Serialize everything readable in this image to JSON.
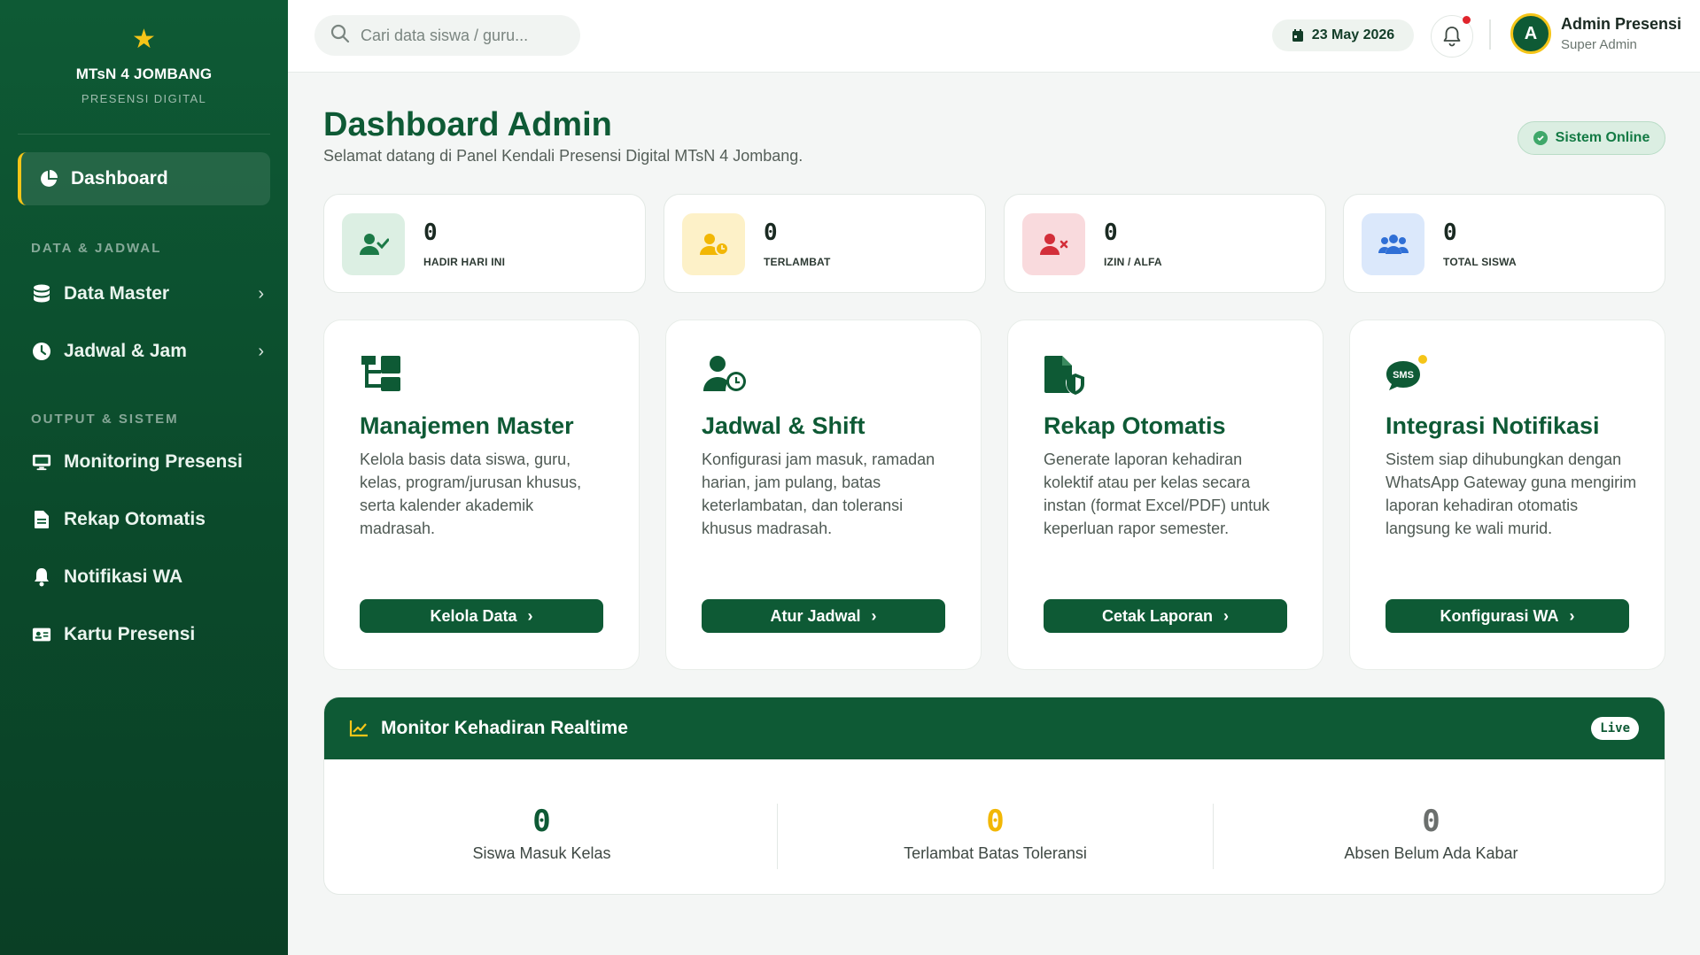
{
  "brand": {
    "name": "MTsN 4 JOMBANG",
    "subtitle": "PRESENSI DIGITAL"
  },
  "sidebar": {
    "active": {
      "label": "Dashboard",
      "icon": "pie-chart-icon"
    },
    "sections": [
      {
        "title": "DATA & JADWAL",
        "items": [
          {
            "label": "Data Master",
            "icon": "database-icon",
            "has_submenu": true
          },
          {
            "label": "Jadwal & Jam",
            "icon": "clock-icon",
            "has_submenu": true
          }
        ]
      },
      {
        "title": "OUTPUT & SISTEM",
        "items": [
          {
            "label": "Monitoring Presensi",
            "icon": "monitor-icon"
          },
          {
            "label": "Rekap Otomatis",
            "icon": "file-icon"
          },
          {
            "label": "Notifikasi WA",
            "icon": "bell-icon"
          },
          {
            "label": "Kartu Presensi",
            "icon": "id-card-icon"
          }
        ]
      }
    ]
  },
  "topbar": {
    "search_placeholder": "Cari data siswa / guru...",
    "date": "23 May 2026",
    "user": {
      "initial": "A",
      "name": "Admin Presensi",
      "role": "Super Admin"
    }
  },
  "header": {
    "title": "Dashboard Admin",
    "subtitle": "Selamat datang di Panel Kendali Presensi Digital MTsN 4 Jombang.",
    "status": "Sistem Online"
  },
  "stats": [
    {
      "value": "0",
      "label": "HADIR HARI INI",
      "icon": "user-check-icon",
      "bg": "#dcefe3",
      "fg": "#1c7a47"
    },
    {
      "value": "0",
      "label": "TERLAMBAT",
      "icon": "user-clock-icon",
      "bg": "#fdf1c8",
      "fg": "#f2b705"
    },
    {
      "value": "0",
      "label": "IZIN / ALFA",
      "icon": "user-x-icon",
      "bg": "#f9dadd",
      "fg": "#d32f3a"
    },
    {
      "value": "0",
      "label": "TOTAL SISWA",
      "icon": "users-icon",
      "bg": "#dbe8fb",
      "fg": "#2f6fd6"
    }
  ],
  "features": [
    {
      "title": "Manajemen Master",
      "desc": "Kelola basis data siswa, guru, kelas, program/jurusan khusus, serta kalender akademik madrasah.",
      "button": "Kelola Data",
      "icon": "sitemap-icon"
    },
    {
      "title": "Jadwal & Shift",
      "desc": "Konfigurasi jam masuk, ramadan harian, jam pulang, batas keterlambatan, dan toleransi khusus madrasah.",
      "button": "Atur Jadwal",
      "icon": "user-clock-icon"
    },
    {
      "title": "Rekap Otomatis",
      "desc": "Generate laporan kehadiran kolektif atau per kelas secara instan (format Excel/PDF) untuk keperluan rapor semester.",
      "button": "Cetak Laporan",
      "icon": "file-shield-icon"
    },
    {
      "title": "Integrasi Notifikasi",
      "desc": "Sistem siap dihubungkan dengan WhatsApp Gateway guna mengirim laporan kehadiran otomatis langsung ke wali murid.",
      "button": "Konfigurasi WA",
      "icon": "sms-icon"
    }
  ],
  "monitor": {
    "title": "Monitor Kehadiran Realtime",
    "badge": "Live",
    "metrics": [
      {
        "value": "0",
        "label": "Siswa Masuk Kelas",
        "color": "#0e5a35"
      },
      {
        "value": "0",
        "label": "Terlambat Batas Toleransi",
        "color": "#f2b705"
      },
      {
        "value": "0",
        "label": "Absen Belum Ada Kabar",
        "color": "#6b6f6d"
      }
    ]
  }
}
